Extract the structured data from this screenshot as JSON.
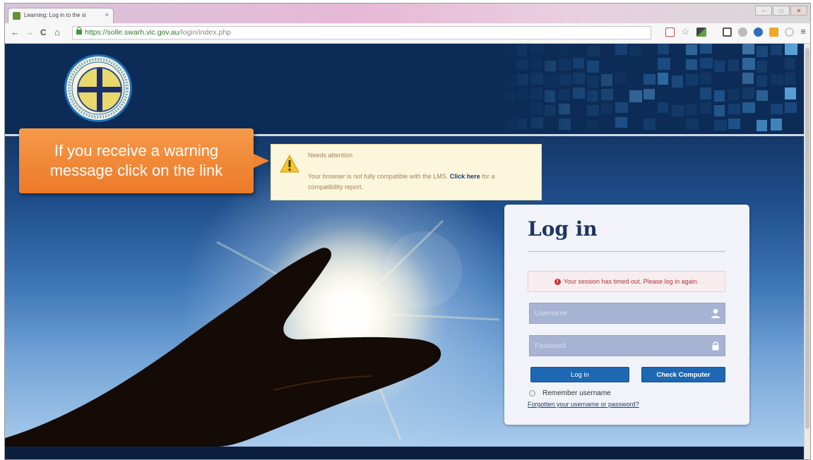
{
  "browser": {
    "tab_title": "Learning: Log in to the si",
    "tab_close": "×",
    "url_host": "https://solle.swarh.vic.gov.au",
    "url_path": "/login/index.php",
    "window_controls": [
      "–",
      "□",
      "✕"
    ],
    "nav": {
      "back": "←",
      "forward": "→",
      "reload": "C",
      "home": "⌂"
    },
    "menu": "≡"
  },
  "site": {
    "logo_alt": "South West Alliance of Rural Health"
  },
  "callout": {
    "text": "If you receive a warning message click on the link"
  },
  "notice": {
    "title": "Needs attention",
    "text_before": "Your browser is not fully compatible with the LMS.",
    "link": "Click here",
    "text_after": "for a compatibility report."
  },
  "login": {
    "title": "Log in",
    "session_alert": "Your session has timed out. Please log in again.",
    "username_placeholder": "Username",
    "password_placeholder": "Password",
    "login_button": "Log in",
    "check_button": "Check Computer",
    "remember_label": "Remember username",
    "forgot_link": "Forgotten your username or password?"
  },
  "colors": {
    "header_navy": "#0c2c57",
    "callout_orange": "#ec7a28",
    "button_blue": "#1e68b3",
    "alert_red": "#b0343f"
  }
}
